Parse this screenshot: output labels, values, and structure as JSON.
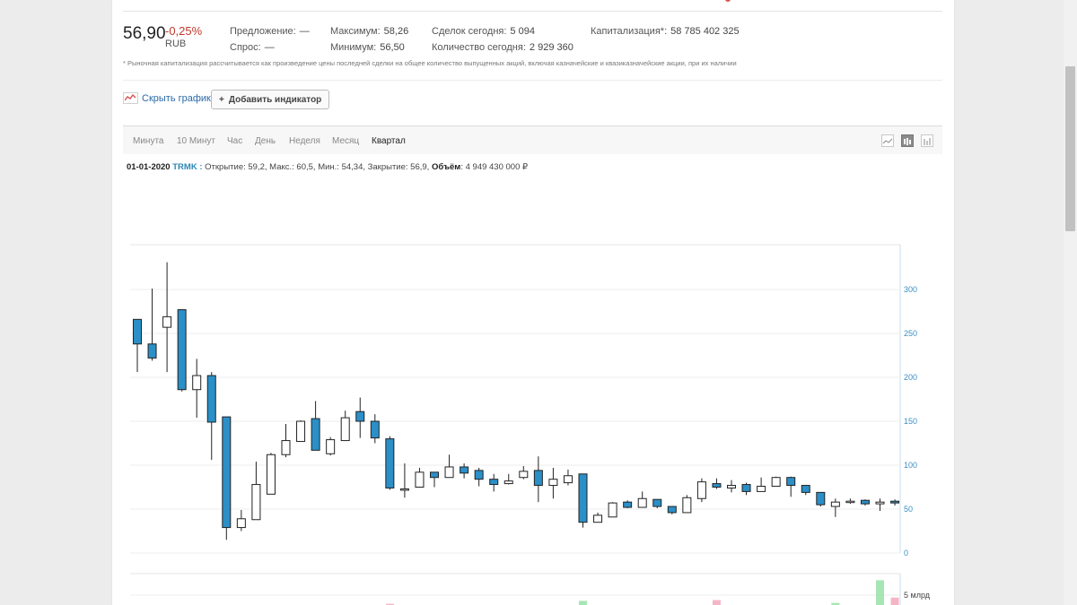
{
  "quote": {
    "price": "56,90",
    "change": "-0,25%",
    "currency": "RUB",
    "offer_label": "Предложение:",
    "offer_value": "—",
    "bid_label": "Спрос:",
    "bid_value": "—",
    "max_label": "Максимум:",
    "max_value": "58,26",
    "min_label": "Минимум:",
    "min_value": "56,50",
    "deals_label": "Сделок сегодня:",
    "deals_value": "5 094",
    "qty_label": "Количество сегодня:",
    "qty_value": "2 929 360",
    "cap_label": "Капитализация*:",
    "cap_value": "58 785 402 325"
  },
  "footnote": "* Рыночная капитализация рассчитывается как произведение цены последней сделки на общее количество выпущенных акций, включая казначейские и квазиказначейские акции, при их наличии",
  "toolbar": {
    "hide_chart_label": "Скрыть график",
    "add_indicator_label": "Добавить индикатор",
    "add_indicator_icon": "+"
  },
  "timeframes": [
    "Минута",
    "10 Минут",
    "Час",
    "День",
    "Неделя",
    "Месяц",
    "Квартал"
  ],
  "active_timeframe": "Квартал",
  "chart_type_icons": [
    "line-chart-icon",
    "candlestick-chart-icon",
    "bar-chart-icon"
  ],
  "ohlc": {
    "date": "01-01-2020",
    "ticker": "TRMK",
    "sep": ":",
    "open_label": "Открытие:",
    "open_value": "59,2,",
    "high_label": "Макс.:",
    "high_value": "60,5,",
    "low_label": "Мин.:",
    "low_value": "54,34,",
    "close_label": "Закрытие:",
    "close_value": "56,9,",
    "volume_label": "Объём",
    "volume_value": ": 4 949 430 000 ₽"
  },
  "colors": {
    "bear": "#2b8fc8",
    "bull": "#ffffff",
    "outline": "#222222",
    "axis_label": "#3a8fc5",
    "change_negative": "#c0392b",
    "link": "#2a6aa8",
    "volume_up": "#a6e6b2",
    "volume_down": "#f4b6c6"
  },
  "chart_data": {
    "type": "candlestick",
    "ylim": [
      0,
      350
    ],
    "yticks": [
      "0",
      "50",
      "100",
      "150",
      "200",
      "250",
      "300"
    ],
    "volume_tick_label": "5 млрд",
    "candles": [
      {
        "o": 266,
        "h": 266,
        "l": 206,
        "c": 238
      },
      {
        "o": 238,
        "h": 301,
        "l": 219,
        "c": 222
      },
      {
        "o": 257,
        "h": 331,
        "l": 206,
        "c": 269
      },
      {
        "o": 277,
        "h": 277,
        "l": 184,
        "c": 186
      },
      {
        "o": 186,
        "h": 221,
        "l": 154,
        "c": 202
      },
      {
        "o": 202,
        "h": 206,
        "l": 106,
        "c": 149
      },
      {
        "o": 155,
        "h": 155,
        "l": 15,
        "c": 29
      },
      {
        "o": 29,
        "h": 49,
        "l": 25,
        "c": 39
      },
      {
        "o": 38,
        "h": 104,
        "l": 38,
        "c": 78
      },
      {
        "o": 67,
        "h": 114,
        "l": 67,
        "c": 112
      },
      {
        "o": 112,
        "h": 147,
        "l": 109,
        "c": 128
      },
      {
        "o": 127,
        "h": 151,
        "l": 127,
        "c": 150
      },
      {
        "o": 153,
        "h": 173,
        "l": 117,
        "c": 117
      },
      {
        "o": 113,
        "h": 132,
        "l": 111,
        "c": 129
      },
      {
        "o": 128,
        "h": 162,
        "l": 128,
        "c": 154
      },
      {
        "o": 161,
        "h": 177,
        "l": 131,
        "c": 150
      },
      {
        "o": 150,
        "h": 158,
        "l": 125,
        "c": 131
      },
      {
        "o": 130,
        "h": 133,
        "l": 72,
        "c": 74
      },
      {
        "o": 73,
        "h": 102,
        "l": 63,
        "c": 73
      },
      {
        "o": 75,
        "h": 97,
        "l": 75,
        "c": 92
      },
      {
        "o": 92,
        "h": 92,
        "l": 75,
        "c": 86
      },
      {
        "o": 86,
        "h": 112,
        "l": 86,
        "c": 98
      },
      {
        "o": 98,
        "h": 102,
        "l": 85,
        "c": 91
      },
      {
        "o": 94,
        "h": 97,
        "l": 76,
        "c": 84
      },
      {
        "o": 84,
        "h": 90,
        "l": 70,
        "c": 78
      },
      {
        "o": 79,
        "h": 90,
        "l": 78,
        "c": 82
      },
      {
        "o": 86,
        "h": 99,
        "l": 84,
        "c": 93
      },
      {
        "o": 94,
        "h": 110,
        "l": 58,
        "c": 77
      },
      {
        "o": 77,
        "h": 97,
        "l": 62,
        "c": 84
      },
      {
        "o": 80,
        "h": 95,
        "l": 77,
        "c": 88
      },
      {
        "o": 90,
        "h": 90,
        "l": 29,
        "c": 35
      },
      {
        "o": 35,
        "h": 46,
        "l": 35,
        "c": 43
      },
      {
        "o": 41,
        "h": 58,
        "l": 41,
        "c": 57
      },
      {
        "o": 58,
        "h": 60,
        "l": 51,
        "c": 52
      },
      {
        "o": 52,
        "h": 70,
        "l": 52,
        "c": 62
      },
      {
        "o": 61,
        "h": 61,
        "l": 51,
        "c": 53
      },
      {
        "o": 53,
        "h": 53,
        "l": 44,
        "c": 46
      },
      {
        "o": 46,
        "h": 66,
        "l": 46,
        "c": 63
      },
      {
        "o": 62,
        "h": 85,
        "l": 58,
        "c": 81
      },
      {
        "o": 79,
        "h": 85,
        "l": 73,
        "c": 75
      },
      {
        "o": 74,
        "h": 83,
        "l": 69,
        "c": 77
      },
      {
        "o": 78,
        "h": 80,
        "l": 66,
        "c": 70
      },
      {
        "o": 70,
        "h": 86,
        "l": 70,
        "c": 76
      },
      {
        "o": 76,
        "h": 87,
        "l": 76,
        "c": 86
      },
      {
        "o": 86,
        "h": 87,
        "l": 64,
        "c": 77
      },
      {
        "o": 77,
        "h": 77,
        "l": 66,
        "c": 69
      },
      {
        "o": 69,
        "h": 69,
        "l": 53,
        "c": 55
      },
      {
        "o": 53,
        "h": 62,
        "l": 41,
        "c": 58
      },
      {
        "o": 59,
        "h": 62,
        "l": 56,
        "c": 59
      },
      {
        "o": 60,
        "h": 61,
        "l": 54,
        "c": 56
      },
      {
        "o": 56,
        "h": 62,
        "l": 48,
        "c": 58
      },
      {
        "o": 59,
        "h": 61,
        "l": 54,
        "c": 57
      }
    ],
    "volume": [
      0,
      0,
      0,
      0,
      0,
      0,
      0,
      0,
      0,
      0,
      0,
      0,
      0,
      0,
      0,
      0,
      0,
      0.3,
      0,
      0,
      0,
      0,
      0,
      0,
      0,
      0,
      0,
      0,
      0,
      0,
      1.0,
      0,
      0,
      0,
      0,
      0,
      0,
      0,
      0,
      1.2,
      0,
      0,
      0,
      0,
      0,
      0,
      0,
      0.5,
      0,
      0,
      6.0,
      1.8
    ],
    "volume_dir": [
      0,
      0,
      0,
      0,
      0,
      0,
      0,
      0,
      0,
      0,
      0,
      0,
      0,
      0,
      0,
      0,
      0,
      -1,
      0,
      0,
      0,
      0,
      0,
      0,
      0,
      0,
      0,
      0,
      0,
      0,
      1,
      0,
      0,
      0,
      0,
      0,
      0,
      0,
      0,
      -1,
      0,
      0,
      0,
      0,
      0,
      0,
      0,
      1,
      0,
      0,
      1,
      -1
    ]
  }
}
